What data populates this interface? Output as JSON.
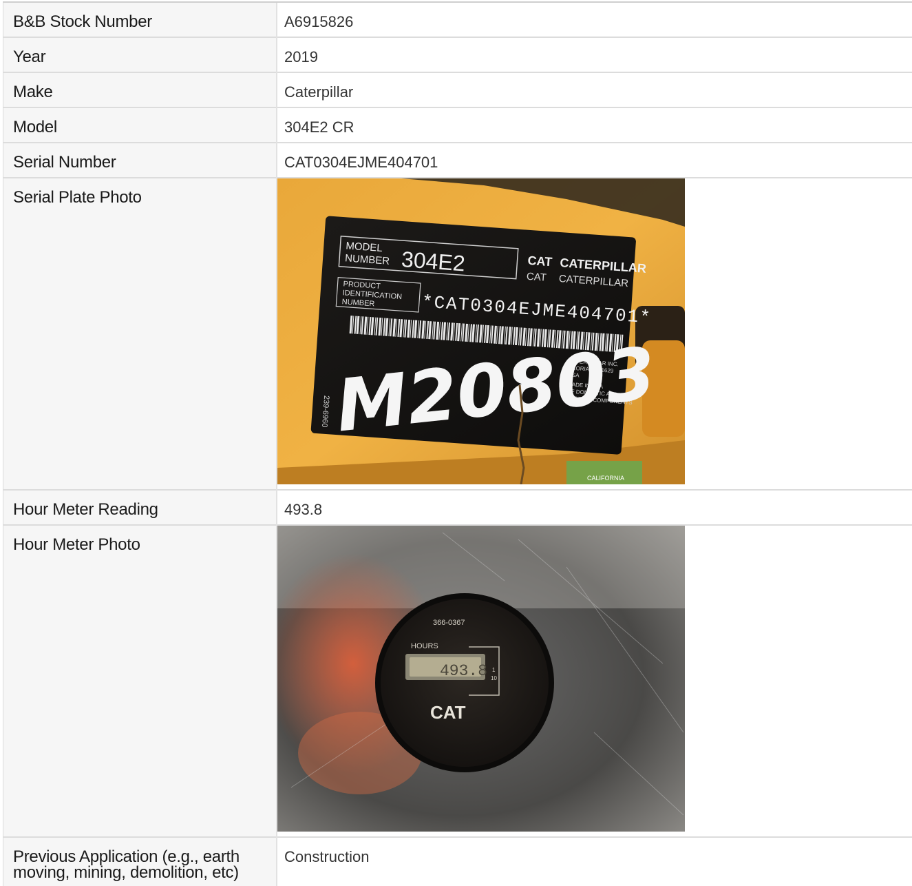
{
  "rows": [
    {
      "label": "B&B Stock Number",
      "value": "A6915826"
    },
    {
      "label": "Year",
      "value": "2019"
    },
    {
      "label": "Make",
      "value": "Caterpillar"
    },
    {
      "label": "Model",
      "value": "304E2 CR"
    },
    {
      "label": "Serial Number",
      "value": "CAT0304EJME404701"
    },
    {
      "label": "Serial Plate Photo"
    },
    {
      "label": "Hour Meter Reading",
      "value": "493.8"
    },
    {
      "label": "Hour Meter Photo"
    },
    {
      "label": "Previous Application (e.g., earth moving, mining, demolition, etc)",
      "value": "Construction"
    }
  ],
  "serial_plate": {
    "model_label_1": "MODEL",
    "model_label_2": "NUMBER",
    "model_value": "304E2",
    "brand_1": "CAT",
    "brand_2": "CATERPILLAR",
    "brand_3": "CAT",
    "brand_4": "CATERPILLAR",
    "pin_label_1": "PRODUCT",
    "pin_label_2": "IDENTIFICATION",
    "pin_label_3": "NUMBER",
    "pin_value": "*CAT0304EJME404701*",
    "maker_1": "CATERPILLAR INC.",
    "maker_2": "PEORIA, IL 61629",
    "maker_3": "USA",
    "made_1": "MADE IN USA",
    "made_2": "OF DOMESTIC AND",
    "made_3": "FOREIGN COMPONENTS",
    "part_no": "239-6960",
    "handwritten": "M20803",
    "sticker": "CALIFORNIA"
  },
  "hour_meter": {
    "part_no": "366-0367",
    "hours_label": "HOURS",
    "reading": "493.8",
    "tenths_1": "1",
    "tenths_2": "10",
    "brand": "CAT"
  }
}
